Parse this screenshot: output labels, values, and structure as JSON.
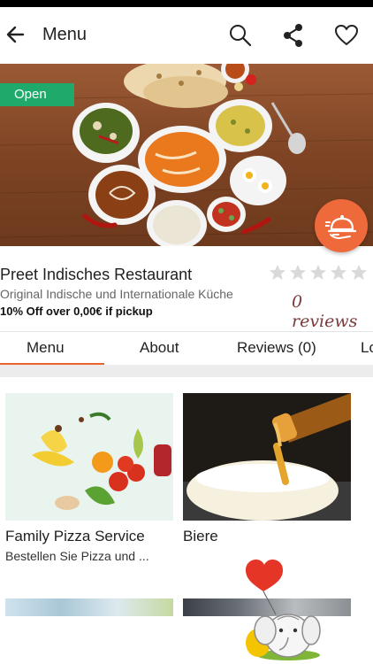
{
  "app_bar": {
    "title": "Menu",
    "back_icon": "arrow-left-icon",
    "actions": [
      "search-icon",
      "share-icon",
      "heart-icon"
    ]
  },
  "hero": {
    "status_badge": "Open",
    "fab_icon": "delivery-cloche-icon",
    "colors": {
      "badge": "#1faa6b",
      "fab": "#ee6a3a"
    }
  },
  "restaurant": {
    "name": "Preet Indisches Restaurant",
    "subtitle": "Original Indische und Internationale Küche",
    "offer": "10% Off over 0,00€ if pickup",
    "rating_stars_filled": 0,
    "rating_stars_total": 5,
    "reviews_text": "0  reviews"
  },
  "tabs": {
    "items": [
      "Menu",
      "About",
      "Reviews (0)",
      "Lo"
    ],
    "active_index": 0,
    "accent": "#e8632e"
  },
  "categories": [
    {
      "title": "Family Pizza Service",
      "description": "Bestellen Sie Pizza und ..."
    },
    {
      "title": "Biere",
      "description": ""
    }
  ]
}
